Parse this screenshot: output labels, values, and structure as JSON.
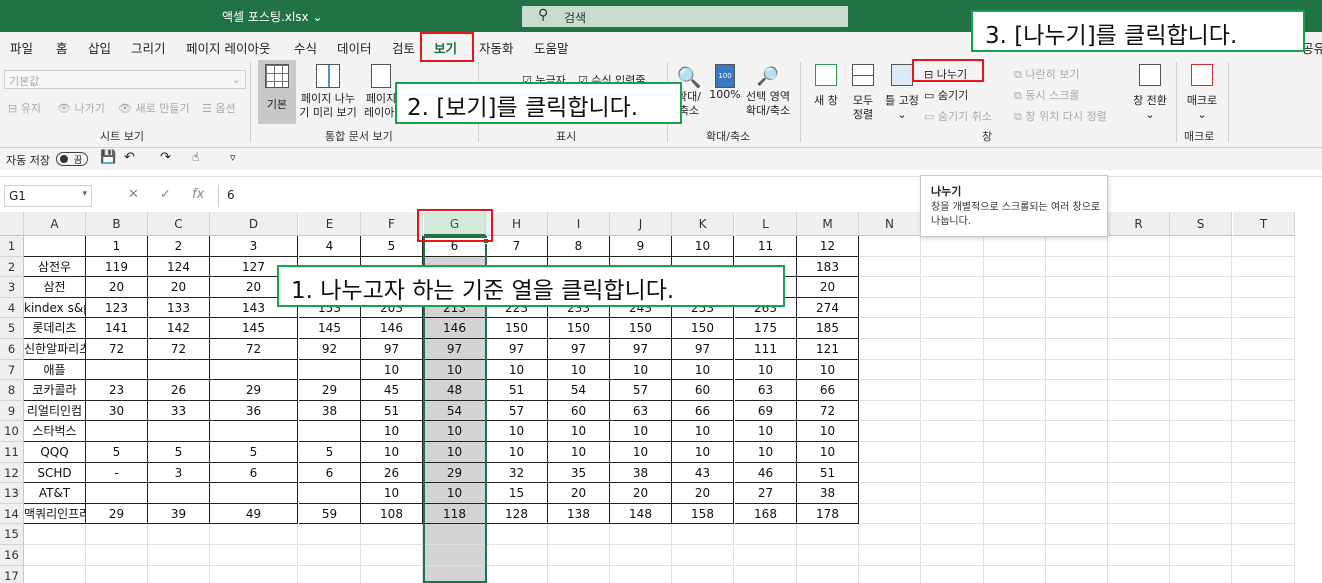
{
  "title_bar": {
    "filename": "액셀 포스팅.xlsx",
    "search_placeholder": "검색"
  },
  "tabs": [
    "파일",
    "홈",
    "삽입",
    "그리기",
    "페이지 레이아웃",
    "수식",
    "데이터",
    "검토",
    "보기",
    "자동화",
    "도움말"
  ],
  "active_tab": "보기",
  "share_label": "공유",
  "ribbon": {
    "sheet_view": {
      "select_value": "기본값",
      "keep": "유지",
      "exit": "나가기",
      "new": "새로 만들기",
      "options": "옵션",
      "label": "시트 보기"
    },
    "workbook_views": {
      "normal": "기본",
      "page_break_line1": "페이지 나누",
      "page_break_line2": "기 미리 보기",
      "page_layout_line1": "페이지",
      "page_layout_line2": "레이아웃",
      "label": "통합 문서 보기"
    },
    "show": {
      "ruler": "눈금자",
      "formula_bar": "수식 입력줄",
      "label": "표시"
    },
    "zoom": {
      "zoom_line1": "확대/",
      "zoom_line2": "축소",
      "hundred": "100%",
      "sel_line1": "선택 영역",
      "sel_line2": "확대/축소",
      "label": "확대/축소"
    },
    "window": {
      "new": "새 창",
      "arrange_line1": "모두",
      "arrange_line2": "정렬",
      "freeze": "틀 고정",
      "split": "나누기",
      "hide": "숨기기",
      "unhide": "숨기기 취소",
      "side_by_side": "나란히 보기",
      "sync_scroll": "동시 스크롤",
      "reset_pos": "창 위치 다시 정렬",
      "switch": "창 전환",
      "label": "창"
    },
    "macros": {
      "macro": "매크로",
      "label": "매크로"
    }
  },
  "qat": {
    "autosave": "자동 저장",
    "toggle": "끔"
  },
  "formula_bar": {
    "name_box": "G1",
    "cancel": "✕",
    "enter": "✓",
    "fx": "fx",
    "value": "6"
  },
  "tooltip": {
    "title": "나누기",
    "description": "창을 개별적으로 스크롤되는 여러 창으로 나눕니다."
  },
  "columns": [
    "A",
    "B",
    "C",
    "D",
    "E",
    "F",
    "G",
    "H",
    "I",
    "J",
    "K",
    "L",
    "M",
    "N",
    "O",
    "P",
    "Q",
    "R",
    "S",
    "T"
  ],
  "selected_column": "G",
  "rows": [
    [
      "",
      "1",
      "2",
      "3",
      "4",
      "5",
      "6",
      "7",
      "8",
      "9",
      "10",
      "11",
      "12"
    ],
    [
      "삼전우",
      "119",
      "124",
      "127",
      "",
      "",
      "",
      "",
      "",
      "",
      "",
      "",
      "183"
    ],
    [
      "삼전",
      "20",
      "20",
      "20",
      "",
      "",
      "",
      "",
      "",
      "",
      "",
      "",
      "20"
    ],
    [
      "kindex s&p",
      "123",
      "133",
      "143",
      "153",
      "203",
      "213",
      "223",
      "233",
      "243",
      "253",
      "263",
      "274"
    ],
    [
      "롯데리츠",
      "141",
      "142",
      "145",
      "145",
      "146",
      "146",
      "150",
      "150",
      "150",
      "150",
      "175",
      "185"
    ],
    [
      "신한알파리츠",
      "72",
      "72",
      "72",
      "92",
      "97",
      "97",
      "97",
      "97",
      "97",
      "97",
      "111",
      "121"
    ],
    [
      "애플",
      "",
      "",
      "",
      "",
      "10",
      "10",
      "10",
      "10",
      "10",
      "10",
      "10",
      "10"
    ],
    [
      "코카콜라",
      "23",
      "26",
      "29",
      "29",
      "45",
      "48",
      "51",
      "54",
      "57",
      "60",
      "63",
      "66"
    ],
    [
      "리얼티인컴",
      "30",
      "33",
      "36",
      "38",
      "51",
      "54",
      "57",
      "60",
      "63",
      "66",
      "69",
      "72"
    ],
    [
      "스타벅스",
      "",
      "",
      "",
      "",
      "10",
      "10",
      "10",
      "10",
      "10",
      "10",
      "10",
      "10"
    ],
    [
      "QQQ",
      "5",
      "5",
      "5",
      "5",
      "10",
      "10",
      "10",
      "10",
      "10",
      "10",
      "10",
      "10"
    ],
    [
      "SCHD",
      "-",
      "3",
      "6",
      "6",
      "26",
      "29",
      "32",
      "35",
      "38",
      "43",
      "46",
      "51"
    ],
    [
      "AT&T",
      "",
      "",
      "",
      "",
      "10",
      "10",
      "15",
      "20",
      "20",
      "20",
      "27",
      "38"
    ],
    [
      "맥쿼리인프라",
      "29",
      "39",
      "49",
      "59",
      "108",
      "118",
      "128",
      "138",
      "148",
      "158",
      "168",
      "178"
    ],
    [],
    [],
    []
  ],
  "annotations": {
    "step1": "1.  나누고자 하는 기준 열을 클릭합니다.",
    "step2": "2. [보기]를 클릭합니다.",
    "step3": "3. [나누기]를 클릭합니다."
  },
  "colors": {
    "excel_green": "#217346",
    "callout_border": "#18a34a",
    "highlight_red": "#e8141c"
  }
}
